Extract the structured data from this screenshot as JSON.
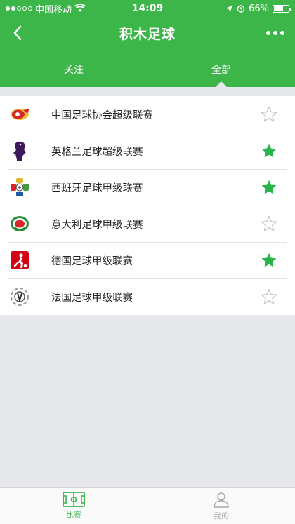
{
  "status_bar": {
    "carrier": "中国移动",
    "time": "14:09",
    "battery": "66%",
    "battery_level": 0.66
  },
  "nav": {
    "title": "积木足球",
    "back_icon": "chevron-left-icon",
    "more_icon": "more-dots-icon"
  },
  "tabs": [
    {
      "label": "关注",
      "active": false
    },
    {
      "label": "全部",
      "active": true
    }
  ],
  "leagues": [
    {
      "name": "中国足球协会超级联赛",
      "starred": false,
      "logo": "csl-logo"
    },
    {
      "name": "英格兰足球超级联赛",
      "starred": true,
      "logo": "premier-league-logo"
    },
    {
      "name": "西班牙足球甲级联赛",
      "starred": true,
      "logo": "la-liga-logo"
    },
    {
      "name": "意大利足球甲级联赛",
      "starred": false,
      "logo": "serie-a-logo"
    },
    {
      "name": "德国足球甲级联赛",
      "starred": true,
      "logo": "bundesliga-logo"
    },
    {
      "name": "法国足球甲级联赛",
      "starred": false,
      "logo": "ligue-1-logo"
    }
  ],
  "tabbar": {
    "items": [
      {
        "label": "比赛",
        "active": true,
        "icon": "football-pitch-icon"
      },
      {
        "label": "我的",
        "active": false,
        "icon": "person-icon"
      }
    ]
  },
  "colors": {
    "brand": "#3cb649",
    "star_active": "#29b54a",
    "star_inactive": "#c4c4c4",
    "tab_inactive": "#a8a8a8"
  }
}
